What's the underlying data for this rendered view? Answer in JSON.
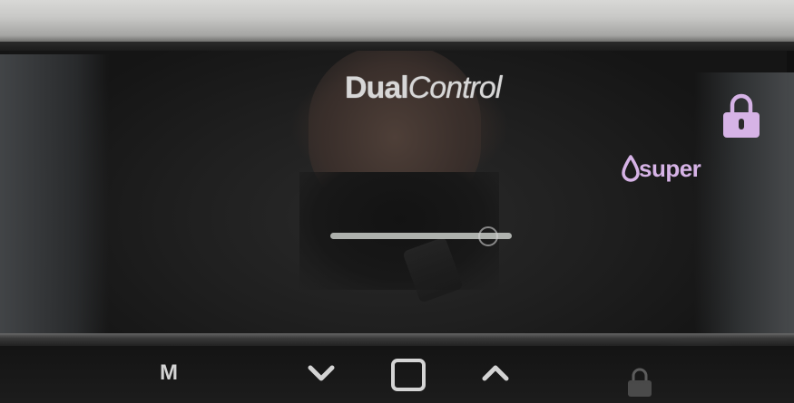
{
  "logo": {
    "part1": "Dual",
    "part2": "Control"
  },
  "super_label": "super",
  "slider_level_percent": 87,
  "buttons": {
    "memory_label": "M"
  },
  "icons": {
    "lock_top": "lock-icon",
    "super": "water-drop-icon",
    "down": "chevron-down-icon",
    "home": "square-icon",
    "up": "chevron-up-icon",
    "lock_bottom": "lock-icon"
  },
  "colors": {
    "accent": "#d6b3e6",
    "text": "#d7d7d7",
    "frame": "#c9c9c7"
  }
}
